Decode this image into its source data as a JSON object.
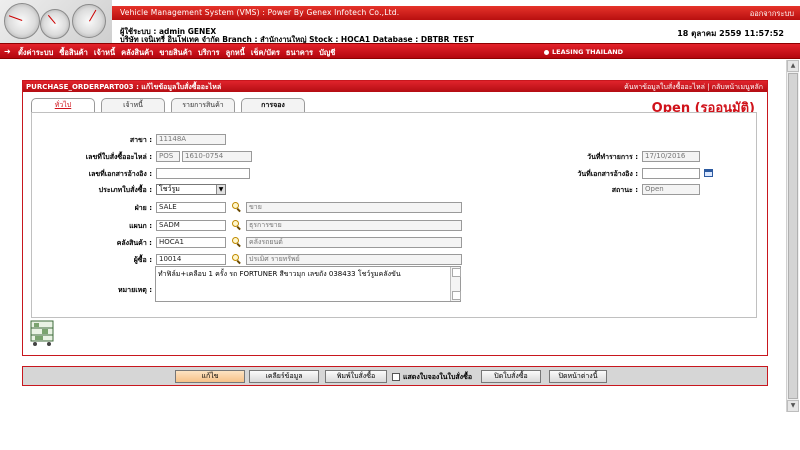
{
  "header": {
    "system_title": "Vehicle Management System (VMS) : Power By Genex Infotech Co.,Ltd.",
    "logout_label": "ออกจากระบบ",
    "user_line": "ผู้ใช้ระบบ : admin GENEX",
    "company_line": "บริษัท เจนิเทรี่ อินโฟเทค จำกัด Branch : สำนักงานใหญ่ Stock : HOCA1 Database : DBTBR_TEST",
    "datetime": "18 ตุลาคม 2559 11:57:52"
  },
  "menu": {
    "items": [
      "ตั้งค่าระบบ",
      "ซื้อสินค้า",
      "เจ้าหนี้",
      "คลังสินค้า",
      "ขายสินค้า",
      "บริการ",
      "ลูกหนี้",
      "เช็ค/บัตร",
      "ธนาคาร",
      "บัญชี"
    ],
    "leasing_label": "LEASING THAILAND"
  },
  "panel": {
    "title": "PURCHASE_ORDERPART003 : แก้ไขข้อมูลใบสั่งซื้ออะไหล่",
    "links": "ค้นหาข้อมูลใบสั่งซื้ออะไหล่ | กลับหน้าเมนูหลัก",
    "status": "Open (รออนุมัติ)",
    "tabs": [
      "ทั่วไป",
      "เจ้าหนี้",
      "รายการสินค้า",
      "การจอง"
    ]
  },
  "form": {
    "branch_label": "สาขา :",
    "branch_value": "11148A",
    "po_no_label": "เลขที่ใบสั่งซื้ออะไหล่ :",
    "po_prefix": "POS",
    "po_number": "1610-0754",
    "ref_doc_label": "เลขที่เอกสารอ้างอิง :",
    "ref_doc_value": "",
    "po_type_label": "ประเภทใบสั่งซื้อ :",
    "po_type_value": "โชว์รูม",
    "doc_date_label": "วันที่ทำรายการ :",
    "doc_date_value": "17/10/2016",
    "ref_date_label": "วันที่เอกสารอ้างอิง :",
    "ref_date_value": "",
    "state_label": "สถานะ :",
    "state_value": "Open",
    "dept_label": "ฝ่าย :",
    "dept_code": "SALE",
    "dept_name": "ขาย",
    "section_label": "แผนก :",
    "section_code": "SADM",
    "section_name": "ธุรการขาย",
    "stock_label": "คลังสินค้า :",
    "stock_code": "HOCA1",
    "stock_name": "คลังรถยนต์",
    "buyer_label": "ผู้ซื้อ :",
    "buyer_code": "10014",
    "buyer_name": "ปรเมิศ รายทรัพย์",
    "remark_label": "หมายเหตุ :",
    "remark_value": "ทำฟิล์ม+เคลือบ 1 ครั้ง รถ FORTUNER สีขาวมุก เลขถัง 038433 โชว์รูมคลังขัน"
  },
  "toolbar": {
    "edit": "แก้ไข",
    "clear": "เคลียร์ข้อมูล",
    "print": "พิมพ์ใบสั่งซื้อ",
    "show_reserve": "แสดงใบจองในใบสั่งซื้อ",
    "close_po": "ปิดใบสั่งซื้อ",
    "close_page": "ปิดหน้าต่างนี้"
  },
  "icons": {
    "lookup": "magnifier-icon",
    "calendar": "calendar-icon",
    "shelf": "shelf-cart-icon"
  },
  "colors": {
    "brand_red": "#d0121a",
    "toolbar_bg": "#d6d6d6"
  }
}
